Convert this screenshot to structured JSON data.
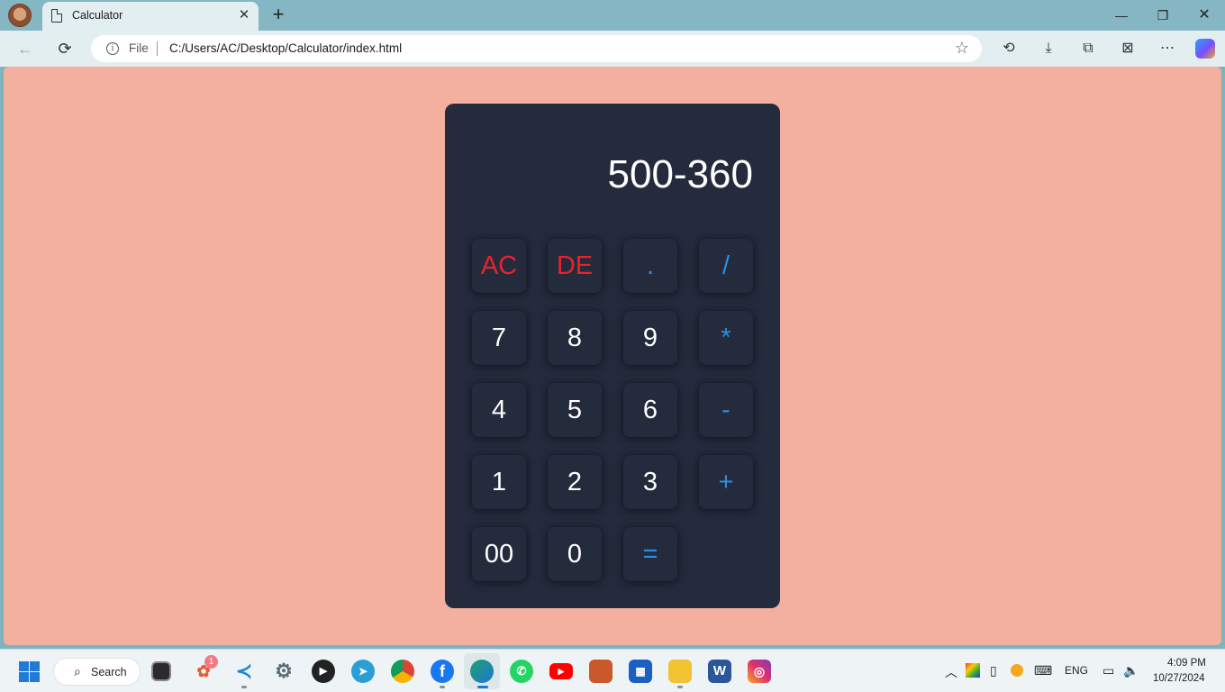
{
  "browser": {
    "tab_title": "Calculator",
    "tab_close": "✕",
    "new_tab": "+",
    "window_controls": {
      "minimize": "—",
      "maximize": "❐",
      "close": "✕"
    },
    "address": {
      "site_label": "File",
      "url": "C:/Users/AC/Desktop/Calculator/index.html"
    },
    "icons": [
      "profile-avatar-icon",
      "page-icon",
      "back-arrow-icon",
      "reload-icon",
      "info-icon",
      "star-icon",
      "history-icon",
      "download-icon",
      "extensions-icon",
      "screenshot-icon",
      "more-icon",
      "copilot-icon"
    ]
  },
  "page": {
    "background_color": "#f3b09f",
    "calculator_color": "#242b3d",
    "accent_red": "#e8232a",
    "accent_blue": "#2b8fe0"
  },
  "calculator": {
    "display": "500-360",
    "keys": [
      {
        "label": "AC",
        "color": "red"
      },
      {
        "label": "DE",
        "color": "red"
      },
      {
        "label": ".",
        "color": "blue"
      },
      {
        "label": "/",
        "color": "blue"
      },
      {
        "label": "7",
        "color": "white"
      },
      {
        "label": "8",
        "color": "white"
      },
      {
        "label": "9",
        "color": "white"
      },
      {
        "label": "*",
        "color": "blue"
      },
      {
        "label": "4",
        "color": "white"
      },
      {
        "label": "5",
        "color": "white"
      },
      {
        "label": "6",
        "color": "white"
      },
      {
        "label": "-",
        "color": "blue"
      },
      {
        "label": "1",
        "color": "white"
      },
      {
        "label": "2",
        "color": "white"
      },
      {
        "label": "3",
        "color": "white"
      },
      {
        "label": "+",
        "color": "blue"
      },
      {
        "label": "00",
        "color": "white"
      },
      {
        "label": "0",
        "color": "white"
      },
      {
        "label": "=",
        "color": "blue"
      }
    ]
  },
  "taskbar": {
    "search_label": "Search",
    "notification_badge": "1",
    "apps": [
      "file-explorer-dark",
      "photos",
      "vscode",
      "settings",
      "media-player",
      "telegram",
      "chrome",
      "facebook",
      "edge",
      "whatsapp",
      "youtube",
      "app",
      "store",
      "file-explorer",
      "word",
      "instagram"
    ],
    "tray": {
      "language": "ENG",
      "time": "4:09 PM",
      "date": "10/27/2024"
    }
  }
}
